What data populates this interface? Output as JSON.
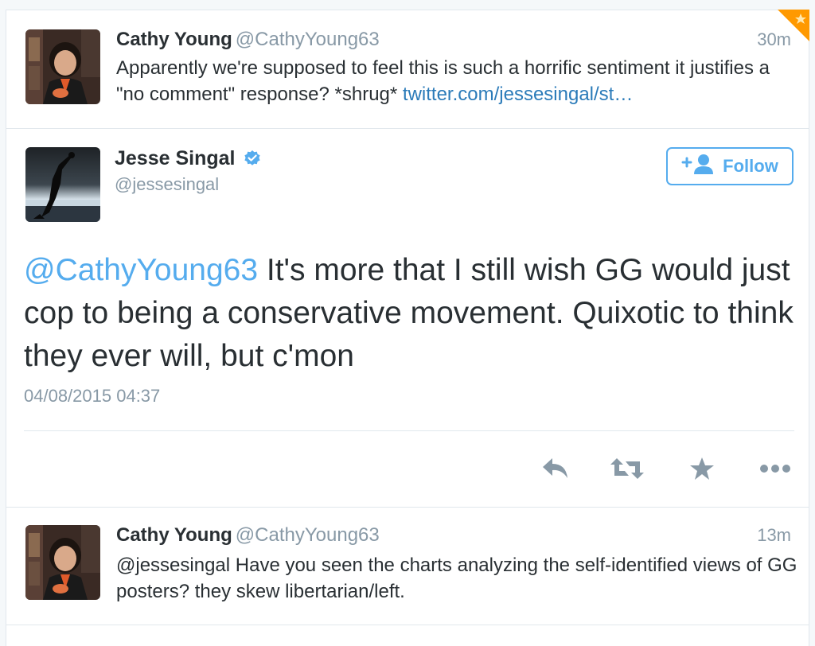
{
  "tweets_above": {
    "name": "Cathy Young",
    "handle": "@CathyYoung63",
    "time": "30m",
    "text_before_link": "Apparently we're supposed to feel this is such a horrific sentiment it justifies a \"no comment\" response? *shrug* ",
    "link": "twitter.com/jessesingal/st…"
  },
  "main_tweet": {
    "name": "Jesse Singal",
    "handle": "@jessesingal",
    "follow_label": "Follow",
    "mention": "@CathyYoung63",
    "text": " It's more that I still wish GG would just cop to being a conservative movement. Quixotic to think they ever will, but c'mon",
    "timestamp": "04/08/2015 04:37",
    "actions": [
      "reply-icon",
      "retweet-icon",
      "favorite-icon",
      "more-icon"
    ]
  },
  "reply_tweet": {
    "name": "Cathy Young",
    "handle": "@CathyYoung63",
    "time": "13m",
    "text": "@jessesingal Have you seen the charts analyzing the self-identified views of GG posters? they skew libertarian/left."
  },
  "colors": {
    "accent": "#55acee",
    "link": "#2b7bb9",
    "muted": "#8899a6",
    "text": "#292f33",
    "favorite_corner": "#ff9900"
  }
}
